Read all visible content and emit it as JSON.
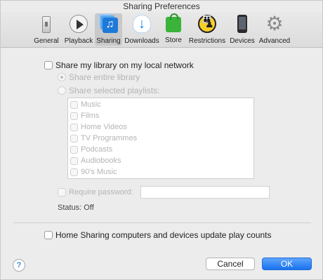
{
  "window": {
    "title": "Sharing Preferences"
  },
  "toolbar": {
    "items": [
      {
        "label": "General",
        "icon": "general-icon"
      },
      {
        "label": "Playback",
        "icon": "playback-icon"
      },
      {
        "label": "Sharing",
        "icon": "sharing-icon",
        "active": true
      },
      {
        "label": "Downloads",
        "icon": "downloads-icon"
      },
      {
        "label": "Store",
        "icon": "store-icon"
      },
      {
        "label": "Restrictions",
        "icon": "restrictions-icon"
      },
      {
        "label": "Devices",
        "icon": "devices-icon"
      },
      {
        "label": "Advanced",
        "icon": "advanced-icon"
      }
    ]
  },
  "sharing": {
    "share_library_label": "Share my library on my local network",
    "share_library_checked": false,
    "share_entire_label": "Share entire library",
    "share_selected_label": "Share selected playlists:",
    "playlists": [
      "Music",
      "Films",
      "Home Videos",
      "TV Programmes",
      "Podcasts",
      "Audiobooks",
      "90's Music"
    ],
    "require_password_label": "Require password:",
    "password_value": "",
    "status_text": "Status: Off",
    "home_sharing_label": "Home Sharing computers and devices update play counts",
    "home_sharing_checked": false
  },
  "footer": {
    "help_label": "?",
    "cancel_label": "Cancel",
    "ok_label": "OK"
  },
  "colors": {
    "accent": "#1a72ef",
    "disabled_text": "#b4b4b4",
    "background": "#ececec"
  }
}
